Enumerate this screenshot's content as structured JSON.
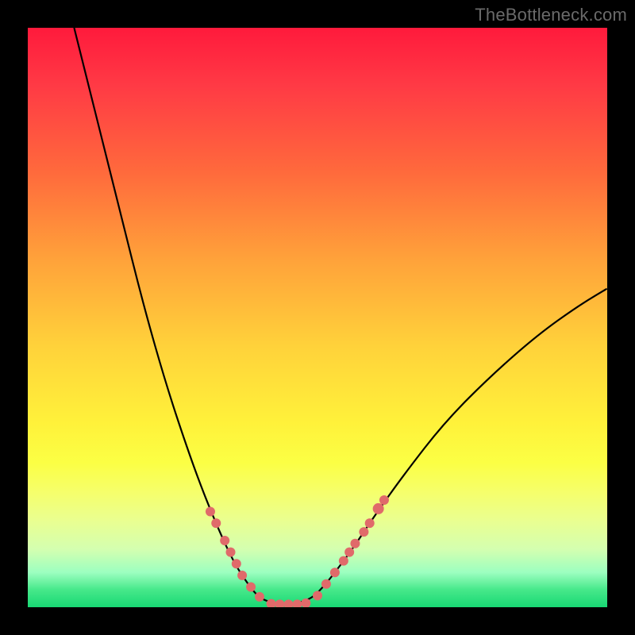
{
  "watermark": {
    "text": "TheBottleneck.com"
  },
  "gradient": {
    "stops": [
      {
        "pos": 0,
        "color": "#ff1a3c"
      },
      {
        "pos": 10,
        "color": "#ff3a45"
      },
      {
        "pos": 25,
        "color": "#ff6a3c"
      },
      {
        "pos": 40,
        "color": "#ffa23a"
      },
      {
        "pos": 55,
        "color": "#ffd23a"
      },
      {
        "pos": 68,
        "color": "#fff13a"
      },
      {
        "pos": 75,
        "color": "#fbff44"
      },
      {
        "pos": 80,
        "color": "#f6ff6a"
      },
      {
        "pos": 85,
        "color": "#eaff90"
      },
      {
        "pos": 90,
        "color": "#d4ffb0"
      },
      {
        "pos": 94,
        "color": "#9cffc0"
      },
      {
        "pos": 97,
        "color": "#46e88a"
      },
      {
        "pos": 100,
        "color": "#18d874"
      }
    ]
  },
  "chart_data": {
    "type": "line",
    "title": "",
    "xlabel": "",
    "ylabel": "",
    "xlim": [
      0,
      100
    ],
    "ylim": [
      0,
      100
    ],
    "curve": [
      {
        "x": 8,
        "y": 100
      },
      {
        "x": 12,
        "y": 84
      },
      {
        "x": 16,
        "y": 68
      },
      {
        "x": 20,
        "y": 52
      },
      {
        "x": 24,
        "y": 38
      },
      {
        "x": 28,
        "y": 26
      },
      {
        "x": 31,
        "y": 18
      },
      {
        "x": 34,
        "y": 11
      },
      {
        "x": 36,
        "y": 7
      },
      {
        "x": 38,
        "y": 4
      },
      {
        "x": 40,
        "y": 1.5
      },
      {
        "x": 43,
        "y": 0.5
      },
      {
        "x": 46,
        "y": 0.5
      },
      {
        "x": 49,
        "y": 1.5
      },
      {
        "x": 51,
        "y": 3.5
      },
      {
        "x": 53,
        "y": 6
      },
      {
        "x": 56,
        "y": 10
      },
      {
        "x": 60,
        "y": 16
      },
      {
        "x": 65,
        "y": 23
      },
      {
        "x": 72,
        "y": 32
      },
      {
        "x": 80,
        "y": 40
      },
      {
        "x": 88,
        "y": 47
      },
      {
        "x": 95,
        "y": 52
      },
      {
        "x": 100,
        "y": 55
      }
    ],
    "markers_left": [
      {
        "x": 31.5,
        "y": 16.5,
        "r": 6
      },
      {
        "x": 32.5,
        "y": 14.5,
        "r": 6
      },
      {
        "x": 34.0,
        "y": 11.5,
        "r": 6
      },
      {
        "x": 35.0,
        "y": 9.5,
        "r": 6
      },
      {
        "x": 36.0,
        "y": 7.5,
        "r": 6
      },
      {
        "x": 37.0,
        "y": 5.5,
        "r": 6
      },
      {
        "x": 38.5,
        "y": 3.5,
        "r": 6
      },
      {
        "x": 40.0,
        "y": 1.8,
        "r": 6
      }
    ],
    "markers_bottom": [
      {
        "x": 42.0,
        "y": 0.6,
        "r": 6
      },
      {
        "x": 43.5,
        "y": 0.5,
        "r": 6
      },
      {
        "x": 45.0,
        "y": 0.5,
        "r": 6
      },
      {
        "x": 46.5,
        "y": 0.5,
        "r": 6
      },
      {
        "x": 48.0,
        "y": 0.7,
        "r": 6
      }
    ],
    "markers_right": [
      {
        "x": 50.0,
        "y": 2.0,
        "r": 6
      },
      {
        "x": 51.5,
        "y": 4.0,
        "r": 6
      },
      {
        "x": 53.0,
        "y": 6.0,
        "r": 6
      },
      {
        "x": 54.5,
        "y": 8.0,
        "r": 6
      },
      {
        "x": 55.5,
        "y": 9.5,
        "r": 6
      },
      {
        "x": 56.5,
        "y": 11.0,
        "r": 6
      },
      {
        "x": 58.0,
        "y": 13.0,
        "r": 6
      },
      {
        "x": 59.0,
        "y": 14.5,
        "r": 6
      },
      {
        "x": 60.5,
        "y": 17.0,
        "r": 7
      },
      {
        "x": 61.5,
        "y": 18.5,
        "r": 6
      }
    ],
    "marker_color": "#e06a6a",
    "curve_color": "#000000"
  }
}
